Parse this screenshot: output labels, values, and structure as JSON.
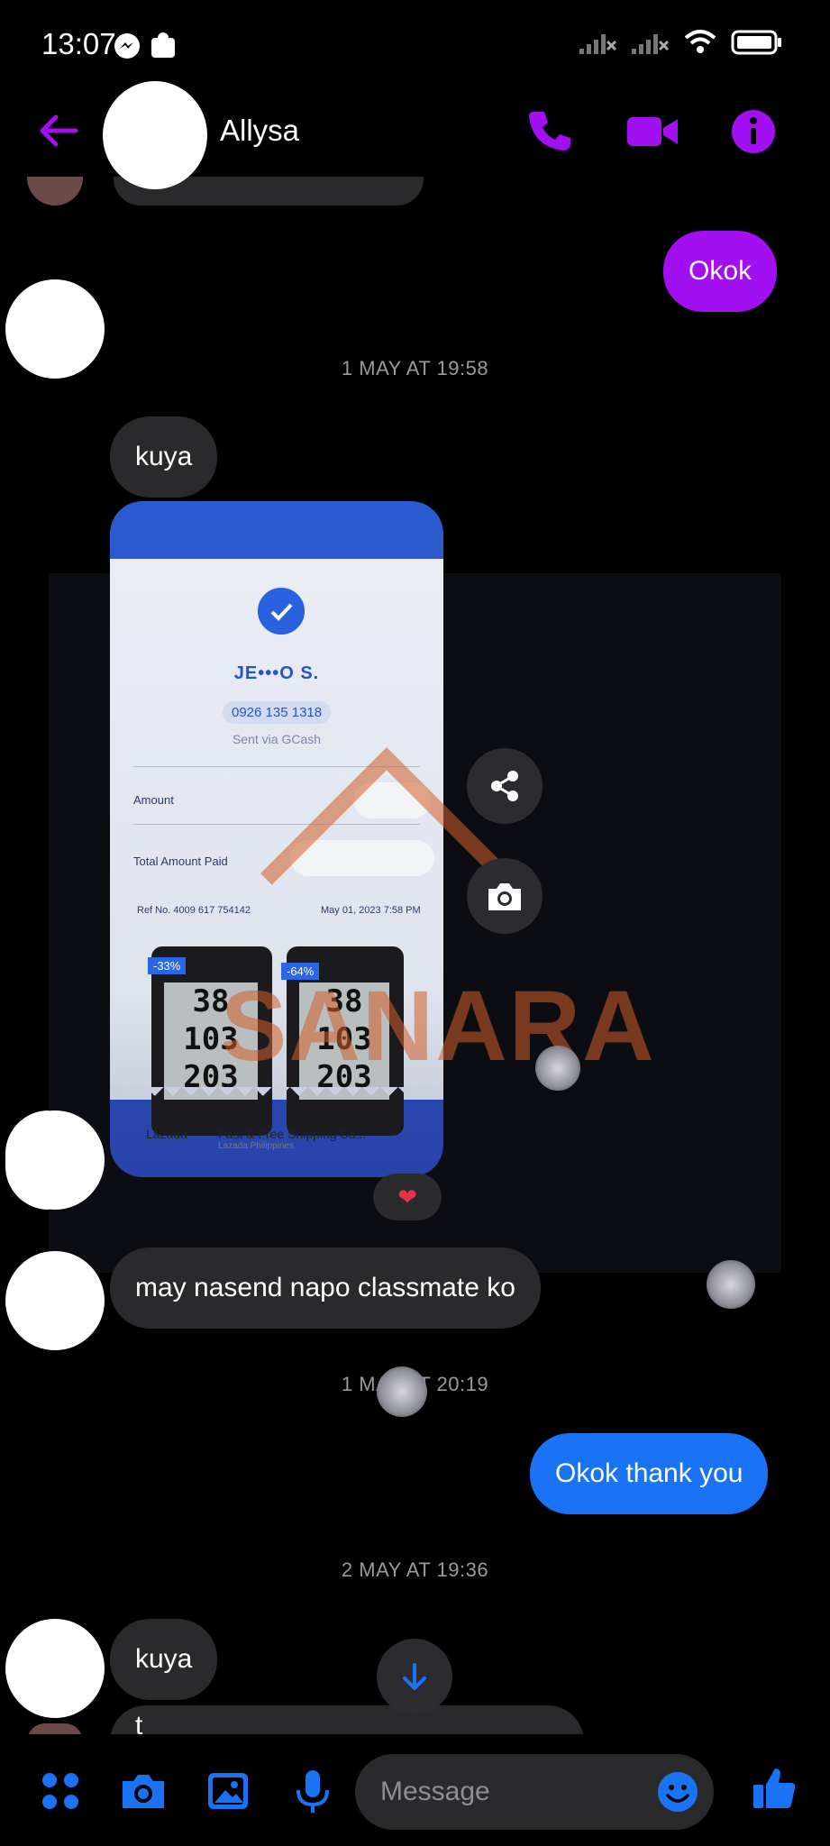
{
  "status_bar": {
    "time": "13:07"
  },
  "header": {
    "contact_name": "Allysa"
  },
  "messages": {
    "okok": "Okok",
    "ts1": "1 MAY AT 19:58",
    "kuya1": "kuya",
    "classmate": "may nasend napo classmate ko",
    "ts2": "1 MAY AT 20:19",
    "thanks": "Okok thank you",
    "ts3": "2 MAY AT 19:36",
    "kuya2": "kuya",
    "partial": "t"
  },
  "receipt": {
    "name": "JE•••O S.",
    "number": "0926 135 1318",
    "sent_via": "Sent via GCash",
    "amount_label": "Amount",
    "total_label": "Total Amount Paid",
    "ref": "Ref No. 4009 617 754142",
    "date": "May 01, 2023 7:58 PM",
    "ad_badge_1": "-33%",
    "ad_badge_2": "-64%",
    "ad_lcd_1": "38\n103\n203",
    "ad_lcd_2": "38\n103\n203",
    "ad_brand": "Lazada",
    "ad_text": "Fast & Free Shipping Sa...",
    "ad_sub": "Lazada Philippines",
    "watermark": "SANARA"
  },
  "reaction": "❤",
  "composer": {
    "placeholder": "Message"
  },
  "colors": {
    "accent_purple": "#a20ff0",
    "accent_blue": "#1a73f5",
    "bubble_in": "#2a2a2c"
  }
}
